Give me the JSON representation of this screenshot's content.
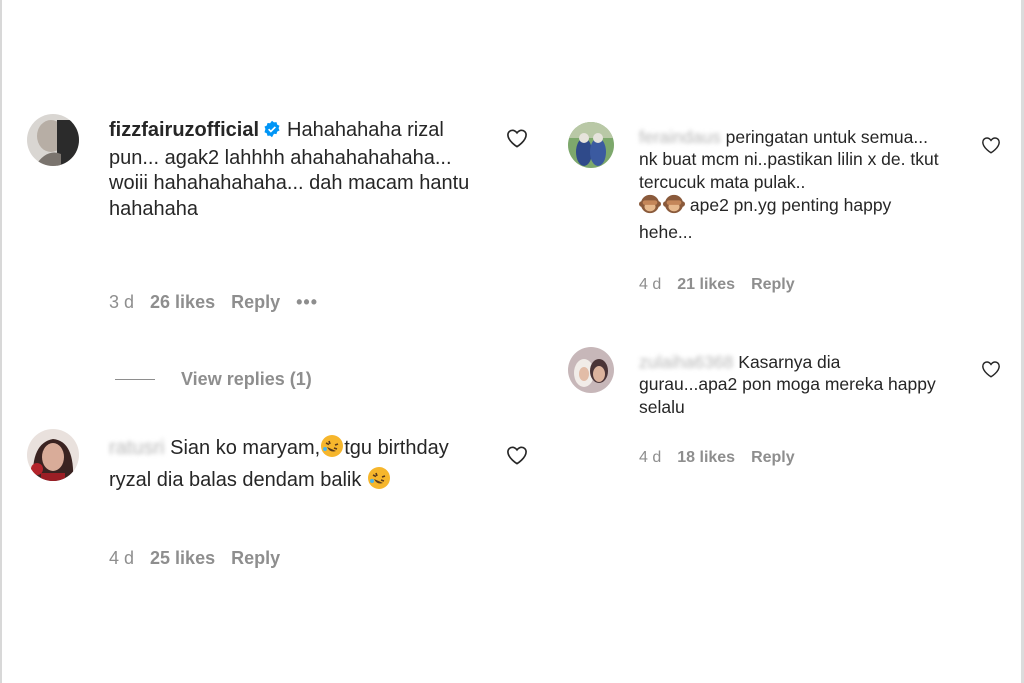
{
  "left": {
    "comment1": {
      "username": "fizzfairuzofficial",
      "text": "Hahahahaha rizal pun... agak2 lahhhh ahahahahahaha... woiii hahahahahaha... dah macam hantu hahahaha",
      "time": "3 d",
      "likes": "26 likes",
      "reply": "Reply",
      "more": "•••",
      "view_replies": "View replies (1)"
    },
    "comment2": {
      "username": "ratusri",
      "text_part1": "Sian ko maryam,",
      "text_part2": "tgu birthday ryzal dia balas dendam balik ",
      "emoji_name": "rolling-on-floor-laughing",
      "time": "4 d",
      "likes": "25 likes",
      "reply": "Reply"
    }
  },
  "right": {
    "comment1": {
      "username": "feraindaus",
      "text_part1": "peringatan untuk semua... nk buat mcm ni..pastikan lilin x de. tkut tercucuk mata pulak..",
      "text_part2": "ape2 pn.yg penting happy hehe...",
      "emoji_name": "see-no-evil-monkey",
      "time": "4 d",
      "likes": "21 likes",
      "reply": "Reply"
    },
    "comment2": {
      "username": "zulaiha6368",
      "text": "Kasarnya dia gurau...apa2 pon moga mereka happy selalu",
      "time": "4 d",
      "likes": "18 likes",
      "reply": "Reply"
    }
  },
  "colors": {
    "text": "#262626",
    "muted": "#8e8e8e",
    "verified": "#0095f6"
  },
  "icons": [
    "heart-outline-icon",
    "verified-badge-icon",
    "more-dots-icon"
  ]
}
